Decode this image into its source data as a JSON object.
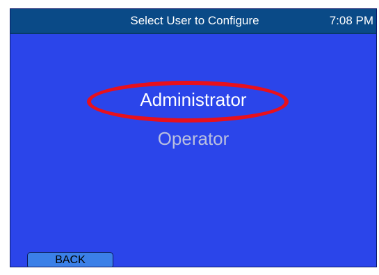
{
  "header": {
    "title": "Select User to Configure",
    "time": "7:08 PM"
  },
  "menu": {
    "items": [
      {
        "label": "Administrator",
        "selected": true
      },
      {
        "label": "Operator",
        "selected": false
      }
    ]
  },
  "footer": {
    "back_label": "BACK"
  },
  "colors": {
    "screen_background": "#2b45ea",
    "header_background": "#0a4a87",
    "selection_highlight": "#e8101c",
    "back_button": "#3b80e8",
    "inactive_text": "#b9bfe0"
  }
}
